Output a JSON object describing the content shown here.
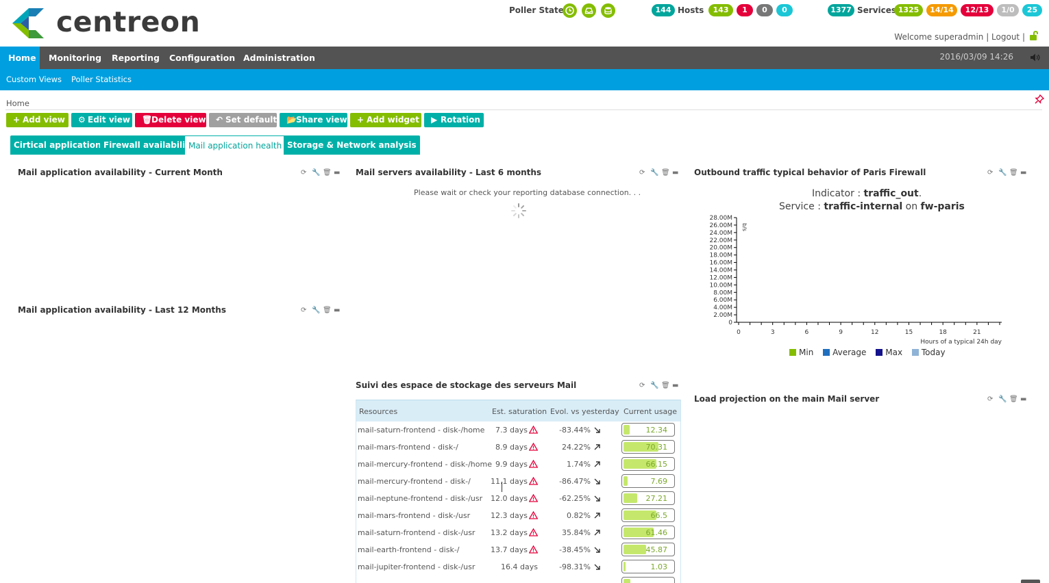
{
  "header": {
    "logo_text": "centreon",
    "poller_label": "Poller States",
    "hosts": {
      "total": "144",
      "label": "Hosts",
      "up": "143",
      "down": "1",
      "unreachable": "0",
      "pending": "0"
    },
    "services": {
      "total": "1377",
      "label": "Services",
      "ok": "1325",
      "warning": "14/14",
      "critical": "12/13",
      "unknown": "1/0",
      "pending": "25"
    },
    "welcome": "Welcome superadmin | Logout |"
  },
  "nav": {
    "items": [
      "Home",
      "Monitoring",
      "Reporting",
      "Configuration",
      "Administration"
    ],
    "datetime": "2016/03/09 14:26"
  },
  "subnav": {
    "items": [
      "Custom  Views",
      "Poller  Statistics"
    ]
  },
  "breadcrumb": "Home",
  "toolbar": {
    "add_view": "Add view",
    "edit_view": "Edit view",
    "delete_view": "Delete view",
    "set_default": "Set default",
    "share_view": "Share view",
    "add_widget": "Add widget",
    "rotation": "Rotation"
  },
  "colors": {
    "green": "#84bd00",
    "teal": "#00b0a8",
    "red": "#e4003a",
    "grey": "#a0a0a0",
    "orange": "#f59a00",
    "blue": "#009fdf"
  },
  "tabs": [
    "Cirtical applications",
    "Firewall availability",
    "Mail application health",
    "Storage & Network analysis"
  ],
  "widgets": {
    "w1": "Mail application availability - Current Month",
    "w2": "Mail servers availability - Last 6 months",
    "w3": "Outbound traffic typical behavior of Paris Firewall",
    "w4": "Mail application availability - Last 12 Months",
    "w5": "Suivi des espace de stockage des serveurs Mail",
    "w6": "Load projection on the main Mail server",
    "wait_message": "Please wait or check your reporting database connection. . ."
  },
  "traffic": {
    "indicator_label": "Indicator : ",
    "indicator": "traffic_out",
    "indicator_end": ".",
    "service_label": "Service : ",
    "service": "traffic-internal",
    "on_label": " on ",
    "host": "fw-paris"
  },
  "chart_data": {
    "type": "line",
    "ylabel": "b/s",
    "xlabel": "Hours of a typical 24h day",
    "y_ticks": [
      "0",
      "2.00M",
      "4.00M",
      "6.00M",
      "8.00M",
      "10.00M",
      "12.00M",
      "14.00M",
      "16.00M",
      "18.00M",
      "20.00M",
      "22.00M",
      "24.00M",
      "26.00M",
      "28.00M"
    ],
    "x_ticks": [
      "0",
      "3",
      "6",
      "9",
      "12",
      "15",
      "18",
      "21"
    ],
    "ylim": [
      0,
      28000000
    ],
    "xlim": [
      0,
      23
    ],
    "series": [
      {
        "name": "Min",
        "color": "#84bd00",
        "values": []
      },
      {
        "name": "Average",
        "color": "#1f6fbf",
        "values": []
      },
      {
        "name": "Max",
        "color": "#14128c",
        "values": []
      },
      {
        "name": "Today",
        "color": "#8fb3d6",
        "values": []
      }
    ]
  },
  "storage": {
    "headers": [
      "Resources",
      "Est. saturation",
      "Evol. vs yesterday",
      "Current usage"
    ],
    "rows": [
      {
        "resource": "mail-saturn-frontend - disk-/home",
        "saturation": "7.3 days",
        "warn": true,
        "evol": "-83.44%",
        "dir": "down",
        "usage": "12.34",
        "pct": 12.34
      },
      {
        "resource": "mail-mars-frontend - disk-/",
        "saturation": "8.9 days",
        "warn": true,
        "evol": "24.22%",
        "dir": "up",
        "usage": "70.31",
        "pct": 70.31
      },
      {
        "resource": "mail-mercury-frontend - disk-/home",
        "saturation": "9.9 days",
        "warn": true,
        "evol": "1.74%",
        "dir": "up",
        "usage": "66.15",
        "pct": 66.15
      },
      {
        "resource": "mail-mercury-frontend - disk-/",
        "saturation": "11.1 days",
        "warn": true,
        "evol": "-86.47%",
        "dir": "down",
        "usage": "7.69",
        "pct": 7.69
      },
      {
        "resource": "mail-neptune-frontend - disk-/usr",
        "saturation": "12.0 days",
        "warn": true,
        "evol": "-62.25%",
        "dir": "down",
        "usage": "27.21",
        "pct": 27.21
      },
      {
        "resource": "mail-mars-frontend - disk-/usr",
        "saturation": "12.3 days",
        "warn": true,
        "evol": "0.82%",
        "dir": "up",
        "usage": "66.5",
        "pct": 66.5
      },
      {
        "resource": "mail-saturn-frontend - disk-/usr",
        "saturation": "13.2 days",
        "warn": true,
        "evol": "35.84%",
        "dir": "up",
        "usage": "61.46",
        "pct": 61.46
      },
      {
        "resource": "mail-earth-frontend - disk-/",
        "saturation": "13.7 days",
        "warn": true,
        "evol": "-38.45%",
        "dir": "down",
        "usage": "45.87",
        "pct": 45.87
      },
      {
        "resource": "mail-jupiter-frontend - disk-/usr",
        "saturation": "16.4 days",
        "warn": false,
        "evol": "-98.31%",
        "dir": "down",
        "usage": "1.03",
        "pct": 1.03
      }
    ]
  }
}
